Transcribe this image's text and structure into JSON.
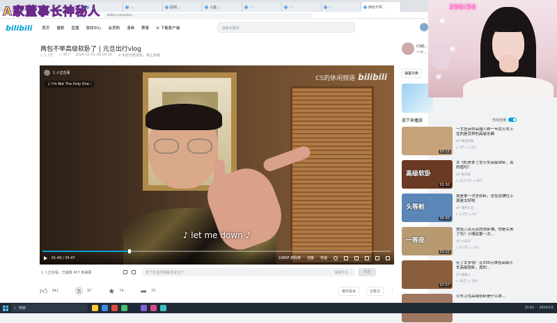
{
  "overlay": {
    "title": "A家董事长神秘人"
  },
  "browser": {
    "tabs": [
      "…",
      "…",
      "贴吧…",
      "斗鱼…",
      "…",
      "…",
      "…",
      "…",
      "…",
      "…",
      "两包不举…"
    ],
    "url": "bilibili.com/video/…"
  },
  "header": {
    "logo": "bilibili",
    "nav": [
      "首页",
      "番剧",
      "直播",
      "游戏中心",
      "会员购",
      "漫画",
      "赛事",
      "④ 下载客户端"
    ],
    "search_placeholder": "搜索关键字"
  },
  "video": {
    "title": "两包不举高级软卧了 | 元旦出行vlog",
    "meta": [
      "▷ 1.7万",
      "▭ 457",
      "2024-01-01 00:00:00",
      "⊘ 未经作者授权，禁止转载"
    ],
    "player": {
      "uploader_count": "1 人正在看",
      "song": "♫ I'm Not The Only One ›",
      "watermark_text": "CS的休闲频道",
      "watermark_brand": "bilibili",
      "subtitle": "♪ let me down ♪",
      "time": "01:40 / 35:47",
      "quality": "1080P 高码率",
      "select_label": "选集",
      "speed_label": "倍速",
      "progress": 0.25
    },
    "danmaku": {
      "info": "1 人正在看，已装载 457 条弹幕",
      "placeholder": "发个友善的弹幕见证当下",
      "etiquette": "弹幕礼仪 ›",
      "send": "发送"
    },
    "actions": {
      "like": "341",
      "coin": "97",
      "fav": "76",
      "share": "70",
      "tag": "标签",
      "note": "记笔记",
      "report": "稿件投诉"
    }
  },
  "sidebar": {
    "up_name": "CS的…",
    "up_desc": "一个…",
    "tab": "弹幕列表"
  },
  "cam": {
    "neon": "290/34"
  },
  "recommend": {
    "header": "接下来播放",
    "autoplay": "自动连播",
    "items": [
      {
        "title": "一文告诉你高端人群一年在火车上住的是怎样的高级车厢",
        "up": "UP 铁道专家",
        "stats": "▷ 3万  ▭ 133",
        "duration": "07:11",
        "thumb_text": "",
        "color": "#c7a27a"
      },
      {
        "title": "太飞机贵爹了坐火车高级软卧，真的值吗？",
        "up": "UP 旅行家",
        "stats": "▷ 117.5万  ▭ 825",
        "duration": "01:50",
        "thumb_text": "高级软卧",
        "color": "#6b3a22"
      },
      {
        "title": "我是第一次坐软卧，坐在这铺位上真是太好啦",
        "up": "UP 旅行小记",
        "stats": "▷ 2.3万  ▭ 61",
        "duration": "05:50",
        "thumb_text": "头等舱",
        "color": "#5a86b8"
      },
      {
        "title": "体验三百元买的软卧铺，你是买贵了吗？小情侣第一次…",
        "up": "UP 小日子",
        "stats": "▷ 8.5万  ▭ 230",
        "duration": "03:22",
        "thumb_text": "一等座",
        "color": "#b89a70"
      },
      {
        "title": "花了太多钱！花335元体验高级火车高级软卧，真的…",
        "up": "UP 铁路人…",
        "stats": "▷ 20万  ▭ 380",
        "duration": "07:57",
        "thumb_text": "",
        "color": "#8a5e3c"
      },
      {
        "title": "火车上住高级软卧是什么体…",
        "up": "",
        "stats": "",
        "duration": "",
        "thumb_text": "",
        "color": "#a07860"
      }
    ]
  },
  "taskbar": {
    "search": "搜索",
    "time": "21:43",
    "date": "2024/1/1"
  }
}
